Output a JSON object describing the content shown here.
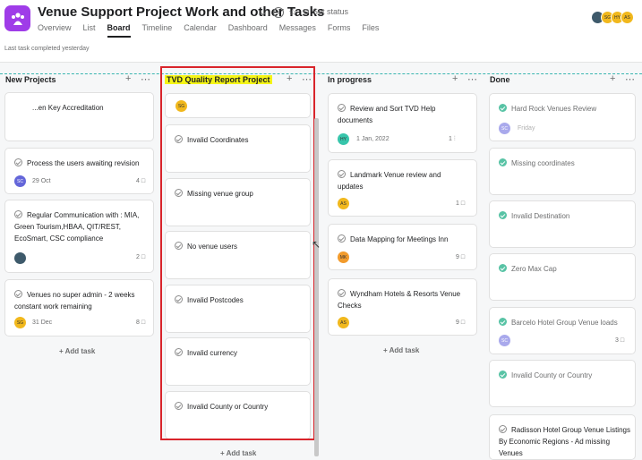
{
  "header": {
    "title": "Venue Support Project Work and other Tasks",
    "status_label": "Set status",
    "last_completed": "Last task completed yesterday",
    "tabs": [
      "Overview",
      "List",
      "Board",
      "Timeline",
      "Calendar",
      "Dashboard",
      "Messages",
      "Forms",
      "Files"
    ],
    "active_tab": "Board",
    "avatars": [
      "",
      "SG",
      "HY",
      "AS"
    ]
  },
  "columns": [
    {
      "name": "New Projects",
      "cards": [
        {
          "title": "...en Key Accreditation"
        },
        {
          "title": "Process the users awaiting revision",
          "avatar": "SC",
          "date": "29 Oct",
          "count": "4"
        },
        {
          "title": "Regular Communication with : MIA, Green Tourism,HBAA, QIT/REST, EcoSmart, CSC compliance",
          "avatar": "",
          "count": "2"
        },
        {
          "title": "Venues no super admin - 2 weeks constant work remaining",
          "avatar": "SG",
          "date": "31 Dec",
          "count": "8"
        }
      ],
      "add_label": "+ Add task"
    },
    {
      "name": "TVD Quality Report Project",
      "cards": [
        {
          "title": "",
          "avatar": "SG"
        },
        {
          "title": "Invalid Coordinates"
        },
        {
          "title": "Missing venue group"
        },
        {
          "title": "No venue users"
        },
        {
          "title": "Invalid Postcodes"
        },
        {
          "title": "Invalid currency"
        },
        {
          "title": "Invalid County or Country"
        }
      ],
      "add_label": "+ Add task"
    },
    {
      "name": "In progress",
      "cards": [
        {
          "title": "Review and Sort TVD Help documents",
          "avatar": "HY",
          "date": "1 Jan, 2022",
          "count": "1"
        },
        {
          "title": "Landmark Venue review and updates",
          "avatar": "AS",
          "count": "1"
        },
        {
          "title": "Data Mapping for Meetings Inn",
          "avatar": "MK",
          "count": "9"
        },
        {
          "title": "Wyndham Hotels & Resorts Venue Checks",
          "avatar": "AS",
          "count": "9"
        }
      ],
      "add_label": "+ Add task"
    },
    {
      "name": "Done",
      "cards": [
        {
          "title": "Hard Rock Venues Review",
          "avatar": "SC",
          "date": "Friday"
        },
        {
          "title": "Missing coordinates"
        },
        {
          "title": "Invalid Destination"
        },
        {
          "title": "Zero Max Cap"
        },
        {
          "title": "Barcelo Hotel Group Venue loads",
          "avatar": "SC",
          "count": "3"
        },
        {
          "title": "Invalid County or Country"
        },
        {
          "title": "Radisson Hotel Group Venue Listings By Economic Regions - Ad missing Venues"
        }
      ]
    }
  ],
  "colors": {
    "app_icon": "#9f3ce8",
    "highlight": "#f5f516",
    "red_box": "#d9242b",
    "done_check": "#58c3a5"
  }
}
